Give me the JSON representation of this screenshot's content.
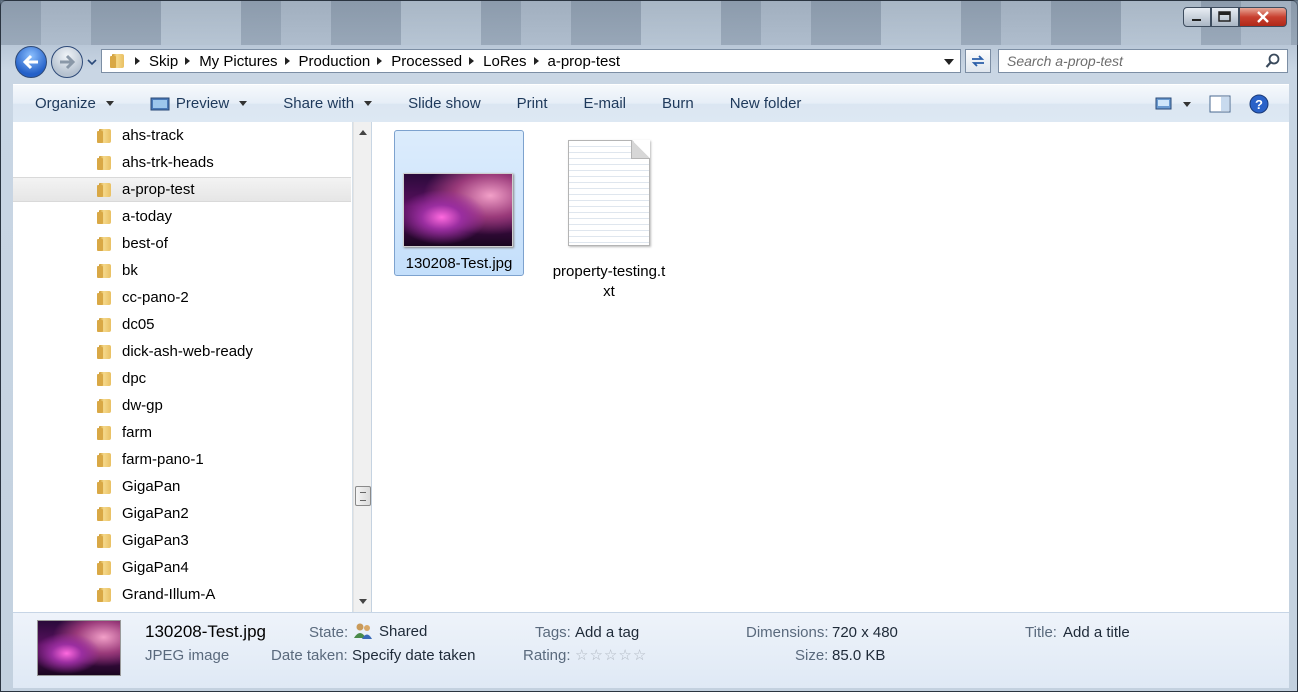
{
  "window": {
    "minimize_icon": "minimize-icon",
    "maximize_icon": "maximize-icon",
    "close_icon": "close-icon"
  },
  "address": {
    "crumbs": [
      "Skip",
      "My Pictures",
      "Production",
      "Processed",
      "LoRes",
      "a-prop-test"
    ],
    "search_placeholder": "Search a-prop-test"
  },
  "toolbar": {
    "organize": "Organize",
    "preview": "Preview",
    "share_with": "Share with",
    "slide_show": "Slide show",
    "print": "Print",
    "email": "E-mail",
    "burn": "Burn",
    "new_folder": "New folder"
  },
  "nav": {
    "items": [
      "ahs-track",
      "ahs-trk-heads",
      "a-prop-test",
      "a-today",
      "best-of",
      "bk",
      "cc-pano-2",
      "dc05",
      "dick-ash-web-ready",
      "dpc",
      "dw-gp",
      "farm",
      "farm-pano-1",
      "GigaPan",
      "GigaPan2",
      "GigaPan3",
      "GigaPan4",
      "Grand-Illum-A"
    ],
    "selected_index": 2
  },
  "files": [
    {
      "name": "130208-Test.jpg",
      "icon": "photo-thumbnail",
      "selected": true
    },
    {
      "name_line1": "property-testing.t",
      "name_line2": "xt",
      "icon": "text-document-icon",
      "selected": false
    }
  ],
  "details": {
    "filename": "130208-Test.jpg",
    "filetype": "JPEG image",
    "state_label": "State:",
    "state_value": "Shared",
    "date_label": "Date taken:",
    "date_value": "Specify date taken",
    "tags_label": "Tags:",
    "tags_value": "Add a tag",
    "rating_label": "Rating:",
    "rating_stars": 0,
    "dimensions_label": "Dimensions:",
    "dimensions_value": "720 x 480",
    "size_label": "Size:",
    "size_value": "85.0 KB",
    "title_label": "Title:",
    "title_value": "Add a title"
  }
}
